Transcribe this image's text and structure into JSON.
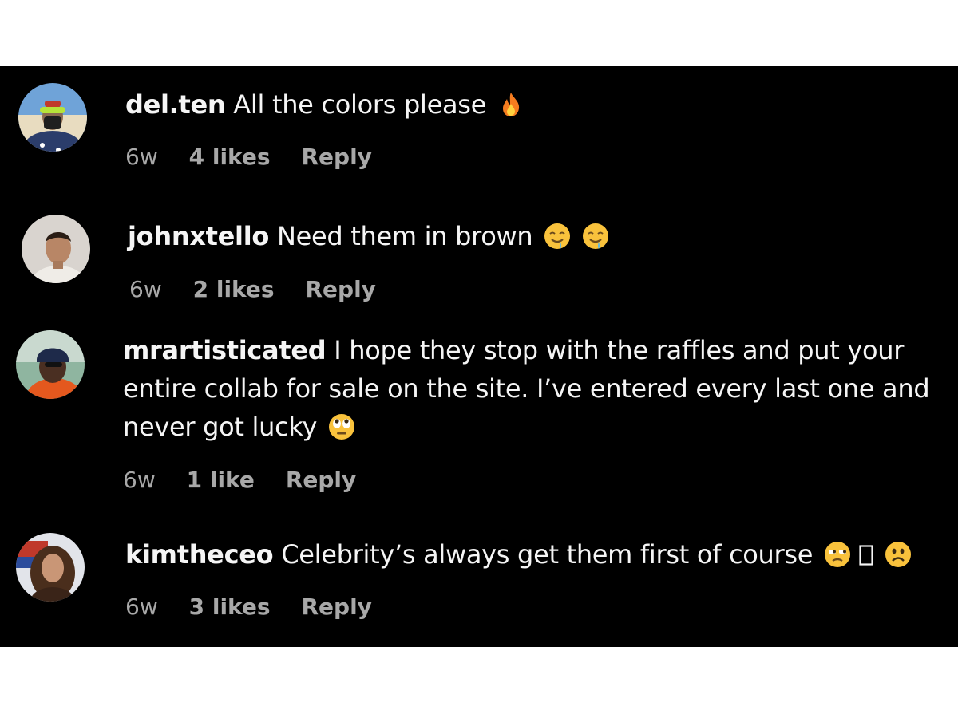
{
  "comments": [
    {
      "username": "del.ten",
      "text": "All the colors please",
      "emoji": [
        "fire-icon"
      ],
      "time": "6w",
      "likes": "4 likes",
      "reply": "Reply"
    },
    {
      "username": "johnxtello",
      "text": "Need them in brown",
      "emoji": [
        "drooling-face-icon",
        "drooling-face-icon"
      ],
      "time": "6w",
      "likes": "2 likes",
      "reply": "Reply"
    },
    {
      "username": "mrartisticated",
      "text": "I hope they stop with the raffles and put your entire collab for sale on the site. I’ve entered every last one and never got lucky",
      "emoji": [
        "rolling-eyes-icon"
      ],
      "time": "6w",
      "likes": "1 like",
      "reply": "Reply"
    },
    {
      "username": "kimtheceo",
      "text": "Celebrity’s always get them first of course",
      "emoji": [
        "unamused-face-icon",
        "missing-glyph-icon",
        "frowning-face-icon"
      ],
      "time": "6w",
      "likes": "3 likes",
      "reply": "Reply"
    }
  ],
  "colors": {
    "background": "#000000",
    "text": "#f5f5f5",
    "meta": "#a8a8a8",
    "emoji_yellow": "#f9c23c"
  }
}
